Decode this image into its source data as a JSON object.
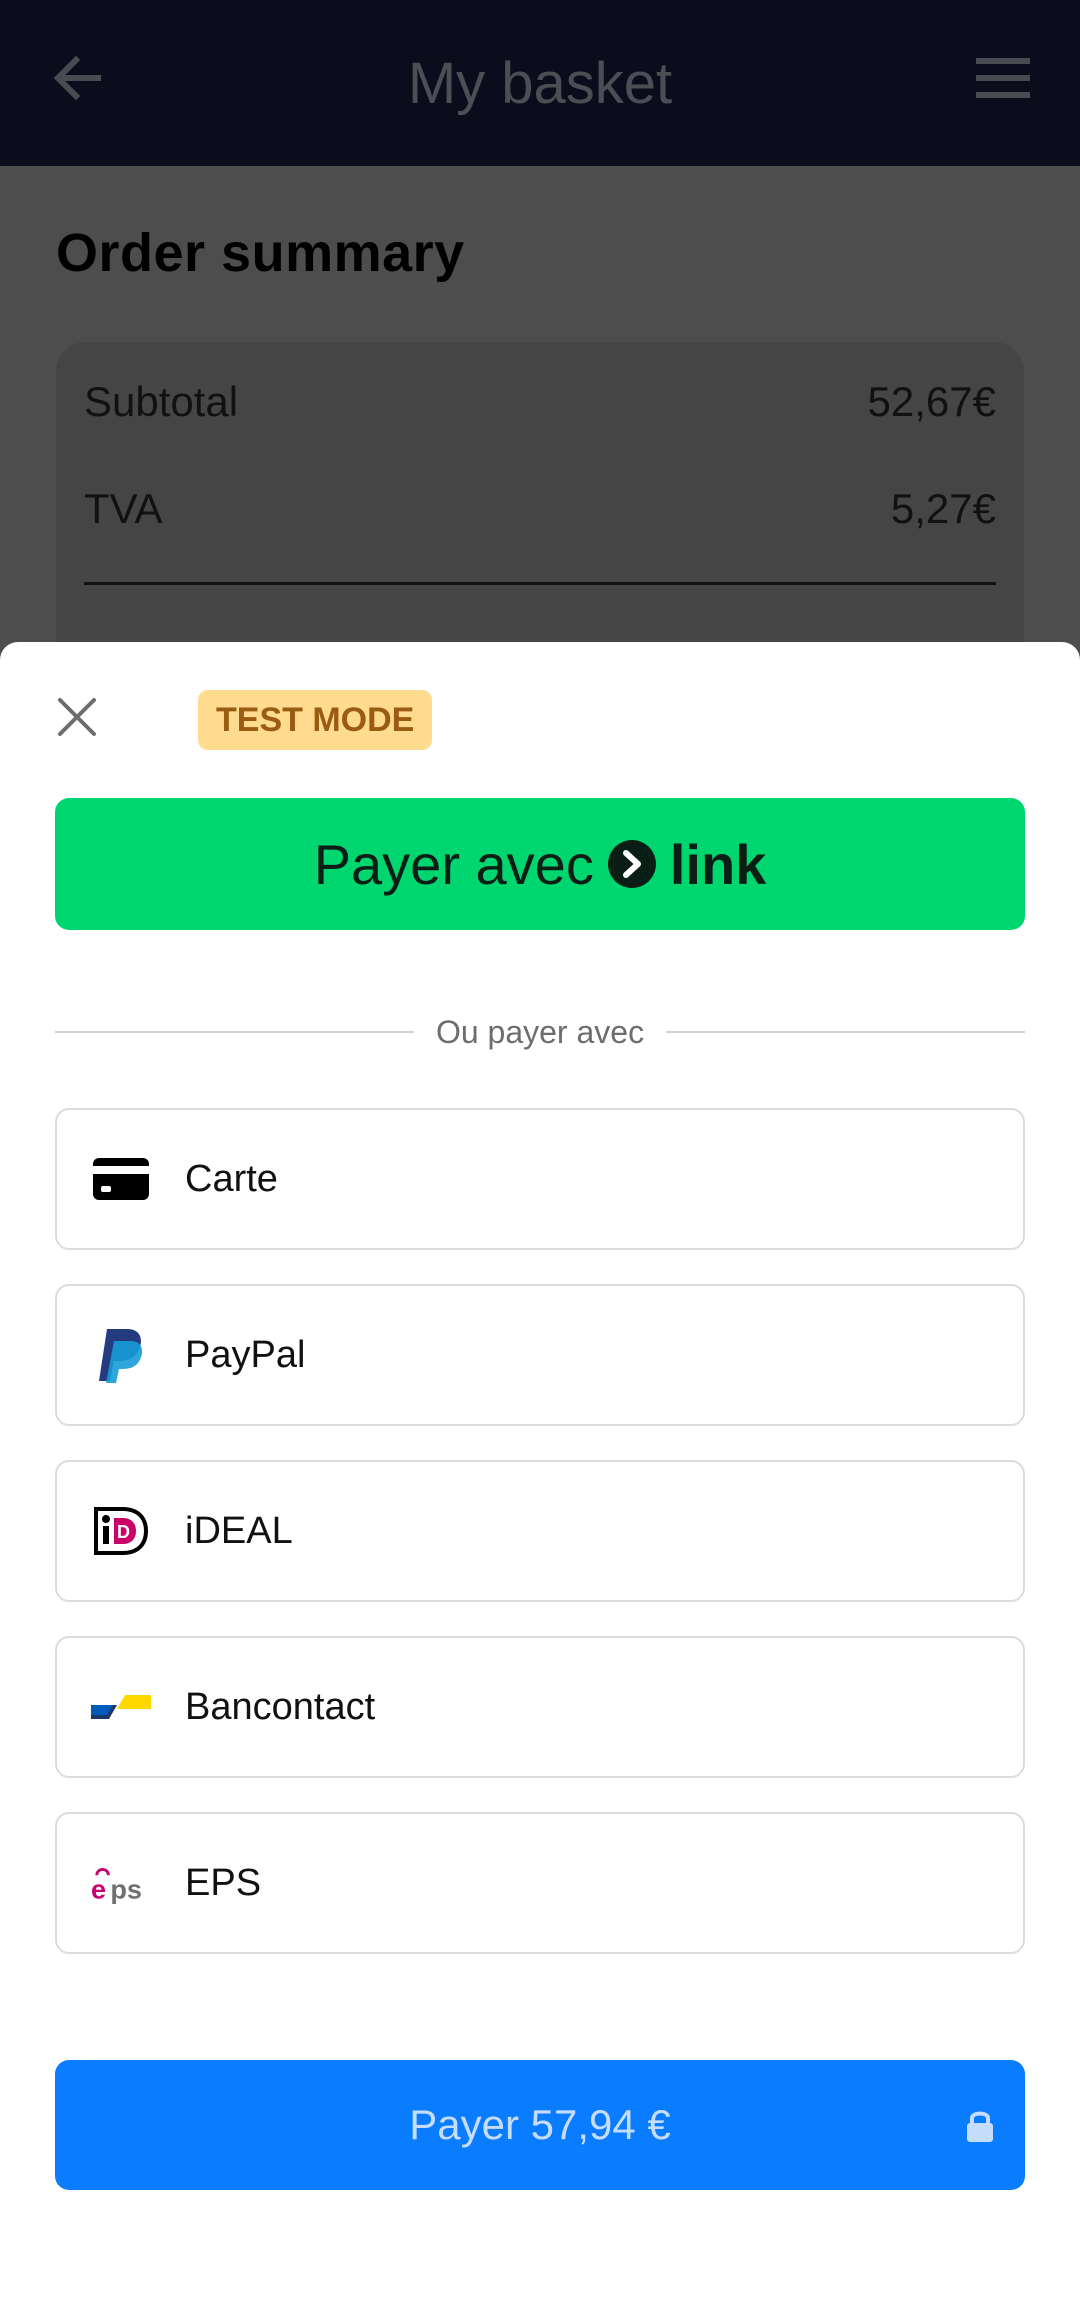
{
  "app_bar": {
    "title": "My basket",
    "back_icon": "arrow-left-icon",
    "menu_icon": "hamburger-menu-icon"
  },
  "order_summary": {
    "title": "Order summary",
    "rows": [
      {
        "label": "Subtotal",
        "value": "52,67€"
      },
      {
        "label": "TVA",
        "value": "5,27€"
      }
    ]
  },
  "sheet": {
    "close_icon": "close-icon",
    "test_badge": "TEST MODE",
    "link_button": {
      "prefix": "Payer avec",
      "brand": "link"
    },
    "divider_text": "Ou payer avec",
    "methods": [
      {
        "label": "Carte",
        "icon": "credit-card-icon"
      },
      {
        "label": "PayPal",
        "icon": "paypal-icon"
      },
      {
        "label": "iDEAL",
        "icon": "ideal-icon"
      },
      {
        "label": "Bancontact",
        "icon": "bancontact-icon"
      },
      {
        "label": "EPS",
        "icon": "eps-icon"
      }
    ],
    "pay_button": "Payer 57,94 €",
    "lock_icon": "lock-icon"
  },
  "colors": {
    "app_bar_bg": "#0c0d1c",
    "overlay_bg": "#4d4d4d",
    "link_green": "#00d66f",
    "pay_blue": "#0a7cff",
    "badge_bg": "#fedb8e",
    "badge_text": "#9a5b12"
  }
}
